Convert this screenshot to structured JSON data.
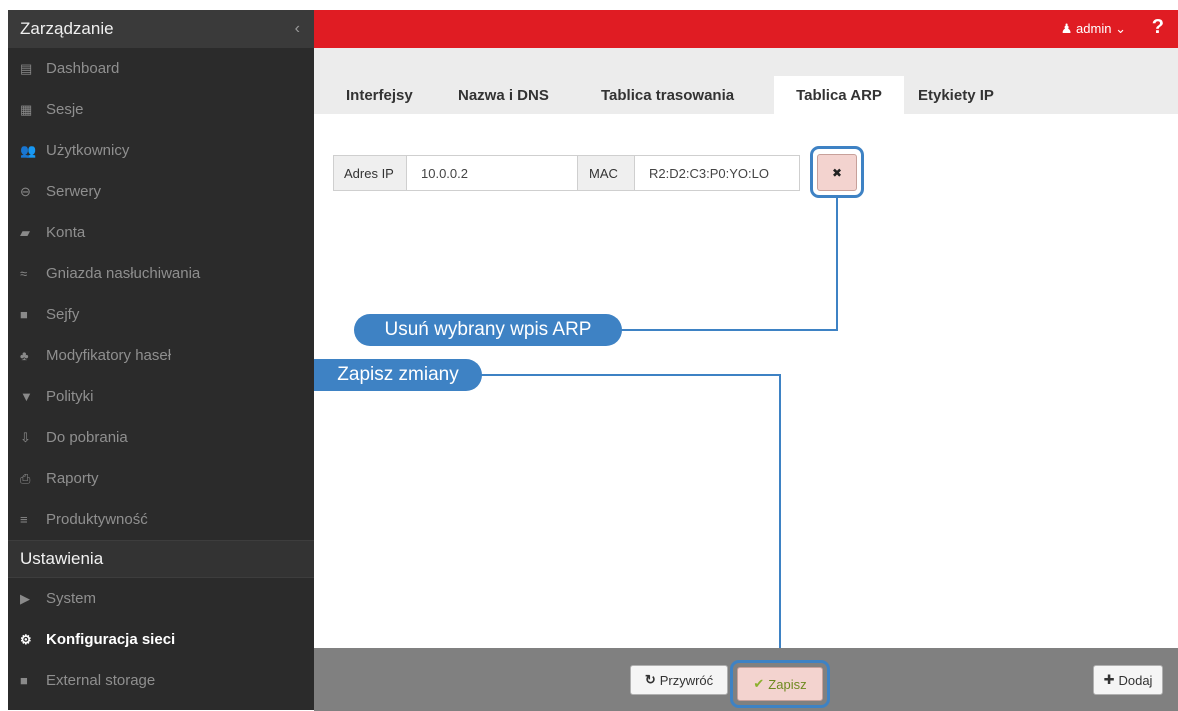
{
  "sidebar": {
    "title": "Zarządzanie",
    "collapse_icon": "‹",
    "items": [
      {
        "label": "Dashboard",
        "icon": "▤"
      },
      {
        "label": "Sesje",
        "icon": "▦"
      },
      {
        "label": "Użytkownicy",
        "icon": "👥"
      },
      {
        "label": "Serwery",
        "icon": "⊖"
      },
      {
        "label": "Konta",
        "icon": "▰"
      },
      {
        "label": "Gniazda nasłuchiwania",
        "icon": "≈"
      },
      {
        "label": "Sejfy",
        "icon": "■"
      },
      {
        "label": "Modyfikatory haseł",
        "icon": "♣"
      },
      {
        "label": "Polityki",
        "icon": "▼"
      },
      {
        "label": "Do pobrania",
        "icon": "⇩"
      },
      {
        "label": "Raporty",
        "icon": "⎙"
      },
      {
        "label": "Produktywność",
        "icon": "≡"
      }
    ],
    "section2": "Ustawienia",
    "items2": [
      {
        "label": "System",
        "icon": "▶"
      },
      {
        "label": "Konfiguracja sieci",
        "icon": "⚙"
      },
      {
        "label": "External storage",
        "icon": "■"
      }
    ]
  },
  "topbar": {
    "user": "admin",
    "user_icon": "♟",
    "user_chevron": "⌄",
    "help": "?",
    "accent": "#e01c23"
  },
  "tabs": [
    "Interfejsy",
    "Nazwa i DNS",
    "Tablica trasowania",
    "Tablica ARP",
    "Etykiety IP"
  ],
  "active_tab": "Tablica ARP",
  "arp": {
    "ip_label": "Adres IP",
    "ip_value": "10.0.0.2",
    "mac_label": "MAC",
    "mac_value": "R2:D2:C3:P0:YO:LO",
    "delete_icon": "✖"
  },
  "callouts": {
    "delete": "Usuń wybrany wpis ARP",
    "save": "Zapisz zmiany",
    "color": "#3e82c4"
  },
  "bottom": {
    "revert": "Przywróć",
    "revert_icon": "↻",
    "save": "Zapisz",
    "save_icon": "✔",
    "add": "Dodaj",
    "add_icon": "✚"
  }
}
